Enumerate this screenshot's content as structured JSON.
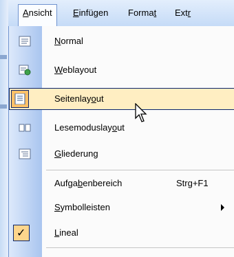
{
  "menubar": {
    "items": [
      {
        "pre": "",
        "u": "A",
        "post": "nsicht"
      },
      {
        "pre": "",
        "u": "E",
        "post": "infügen"
      },
      {
        "pre": "Forma",
        "u": "t",
        "post": ""
      },
      {
        "pre": "Ext",
        "u": "r",
        "post": ""
      }
    ]
  },
  "menu": {
    "items": [
      {
        "pre": "",
        "u": "N",
        "post": "ormal",
        "icon": "normal-view-icon"
      },
      {
        "pre": "",
        "u": "W",
        "post": "eblayout",
        "icon": "web-layout-icon"
      },
      {
        "pre": "Seitenlay",
        "u": "o",
        "post": "ut",
        "icon": "print-layout-icon"
      },
      {
        "pre": "Lesemoduslay",
        "u": "o",
        "post": "ut",
        "icon": "reading-layout-icon"
      },
      {
        "pre": "",
        "u": "G",
        "post": "liederung",
        "icon": "outline-icon"
      },
      {
        "pre": "Aufga",
        "u": "b",
        "post": "enbereich",
        "shortcut": "Strg+F1"
      },
      {
        "pre": "",
        "u": "S",
        "post": "ymbolleisten"
      },
      {
        "pre": "",
        "u": "L",
        "post": "ineal",
        "check": "✓"
      }
    ]
  },
  "colors": {
    "highlight": "#ffeec2",
    "border": "#0a246a",
    "gutter": "#a9c5ef"
  }
}
